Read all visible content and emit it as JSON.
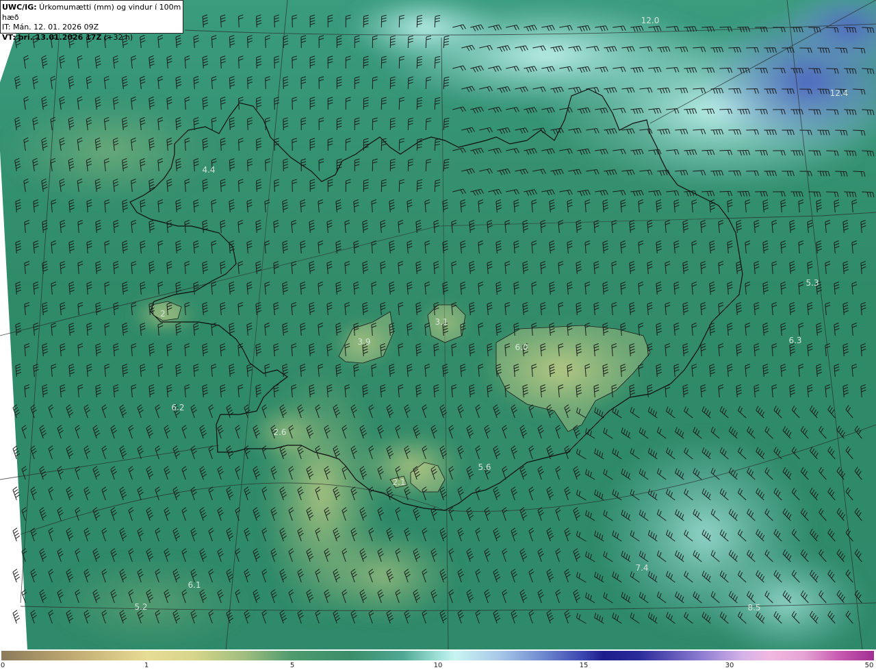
{
  "info": {
    "title_prefix": "UWC/IG:",
    "title_rest": " Úrkomumætti (mm) og vindur í 100m hæð",
    "it_line": "IT: Mán. 12. 01. 2026 09Z",
    "vt_bold": "VT: þri. 13.01.2026 17Z",
    "vt_rest": " (+32 h)"
  },
  "map_values": [
    "12.0",
    "12.4",
    "4.4",
    "5.3",
    "6.3",
    "3.1",
    "3.9",
    "6.0",
    "6.2",
    "2.6",
    "5.6",
    "2.1",
    "7.4",
    "6.1",
    "5.2",
    "8.5",
    "2"
  ],
  "colorbar": {
    "ticks": [
      "0",
      "1",
      "5",
      "10",
      "15",
      "30",
      "50"
    ],
    "tick_values": [
      0,
      1,
      5,
      10,
      15,
      30,
      50
    ]
  },
  "colors": {
    "sea_green": "#2f8f6c",
    "land_dark": "#2c7a5c",
    "land_light": "#c9d28a",
    "north_cyan": "#bff2ee",
    "north_blue": "#5e78c8",
    "barb": "#1a1a1a",
    "coast": "#0d0d0d"
  }
}
